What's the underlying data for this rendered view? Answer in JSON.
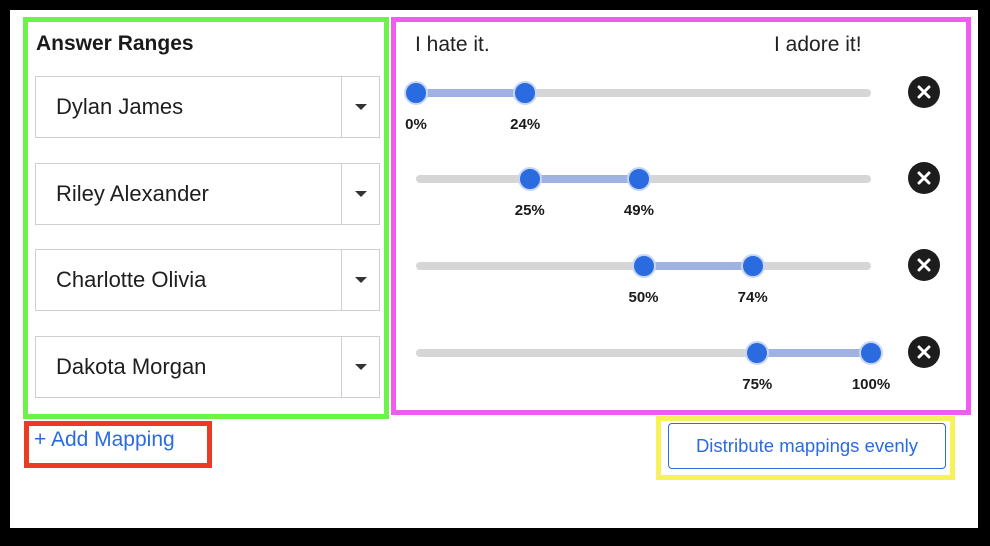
{
  "answer_ranges": {
    "title": "Answer Ranges",
    "items": [
      {
        "value": "Dylan James"
      },
      {
        "value": "Riley Alexander"
      },
      {
        "value": "Charlotte Olivia"
      },
      {
        "value": "Dakota Morgan"
      }
    ]
  },
  "scale": {
    "min_label": "I hate it.",
    "max_label": "I adore it!"
  },
  "sliders": [
    {
      "start": 0,
      "end": 24,
      "start_label": "0%",
      "end_label": "24%"
    },
    {
      "start": 25,
      "end": 49,
      "start_label": "25%",
      "end_label": "49%"
    },
    {
      "start": 50,
      "end": 74,
      "start_label": "50%",
      "end_label": "74%"
    },
    {
      "start": 75,
      "end": 100,
      "start_label": "75%",
      "end_label": "100%"
    }
  ],
  "actions": {
    "add_mapping": "+ Add Mapping",
    "distribute": "Distribute mappings evenly"
  },
  "colors": {
    "accent": "#2a6be0",
    "range_fill": "#9fb2e2",
    "track": "#d6d6d6",
    "highlight_green": "#6cf24a",
    "highlight_magenta": "#ef5cf2",
    "highlight_red": "#ea3c24",
    "highlight_yellow": "#f8f25a"
  },
  "icons": {
    "dropdown": "caret-down-icon",
    "remove": "close-icon"
  }
}
